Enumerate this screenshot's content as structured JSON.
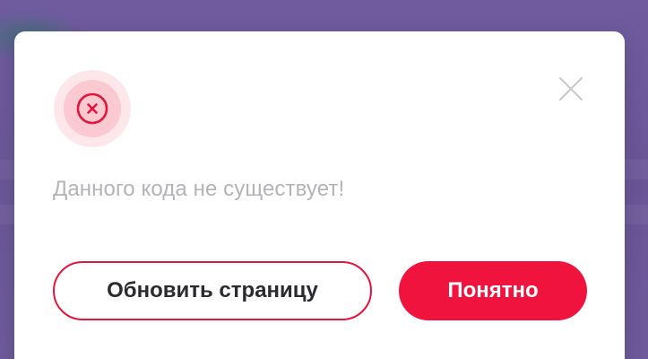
{
  "dialog": {
    "icon": "error-circle-x-icon",
    "close_icon": "close-icon",
    "message": "Данного кода не существует!",
    "buttons": {
      "refresh_label": "Обновить страницу",
      "ok_label": "Понятно"
    }
  },
  "colors": {
    "accent": "#f0133e",
    "outline": "#e5143b",
    "overlay": "#6e5a9c",
    "message_text": "#b3b3b8",
    "icon_halo": "#fde7ea"
  }
}
